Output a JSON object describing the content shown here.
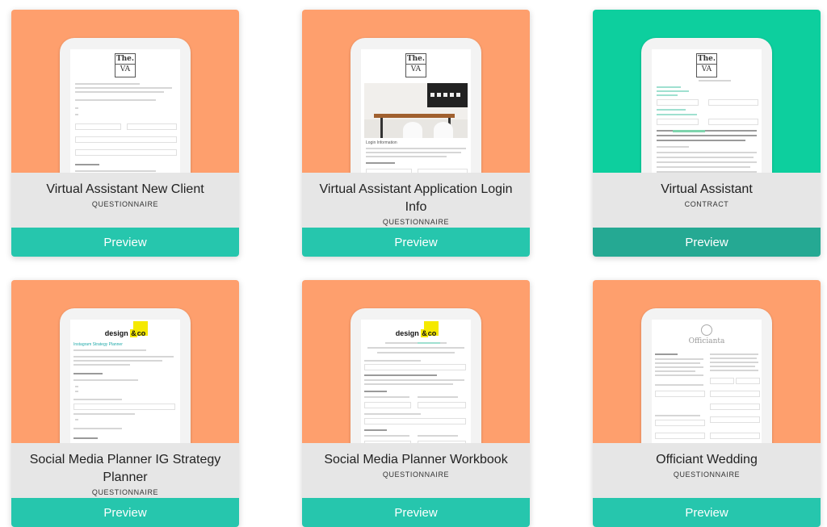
{
  "colors": {
    "orange": "#fe9f6d",
    "teal_hero": "#0dcf9e",
    "preview_teal": "#26c6ad",
    "preview_teal_hover": "#25a993",
    "title_band": "#e6e6e6"
  },
  "cards": [
    {
      "title": "Virtual Assistant New Client",
      "type": "QUESTIONNAIRE",
      "preview_label": "Preview",
      "logo": [
        "The.",
        "VA"
      ]
    },
    {
      "title": "Virtual Assistant Application Login Info",
      "type": "QUESTIONNAIRE",
      "preview_label": "Preview",
      "logo": [
        "The.",
        "VA"
      ],
      "screen_heading": "Login Information"
    },
    {
      "title": "Virtual Assistant",
      "type": "CONTRACT",
      "preview_label": "Preview",
      "logo": [
        "The.",
        "VA"
      ]
    },
    {
      "title": "Social Media Planner IG Strategy Planner",
      "type": "QUESTIONNAIRE",
      "preview_label": "Preview",
      "logo": [
        "design ",
        "co"
      ],
      "screen_heading": "Instagram Strategy Planner"
    },
    {
      "title": "Social Media Planner Workbook",
      "type": "QUESTIONNAIRE",
      "preview_label": "Preview",
      "logo": [
        "design ",
        "co"
      ]
    },
    {
      "title": "Officiant Wedding",
      "type": "QUESTIONNAIRE",
      "preview_label": "Preview",
      "logo": [
        "Officianta"
      ]
    }
  ]
}
